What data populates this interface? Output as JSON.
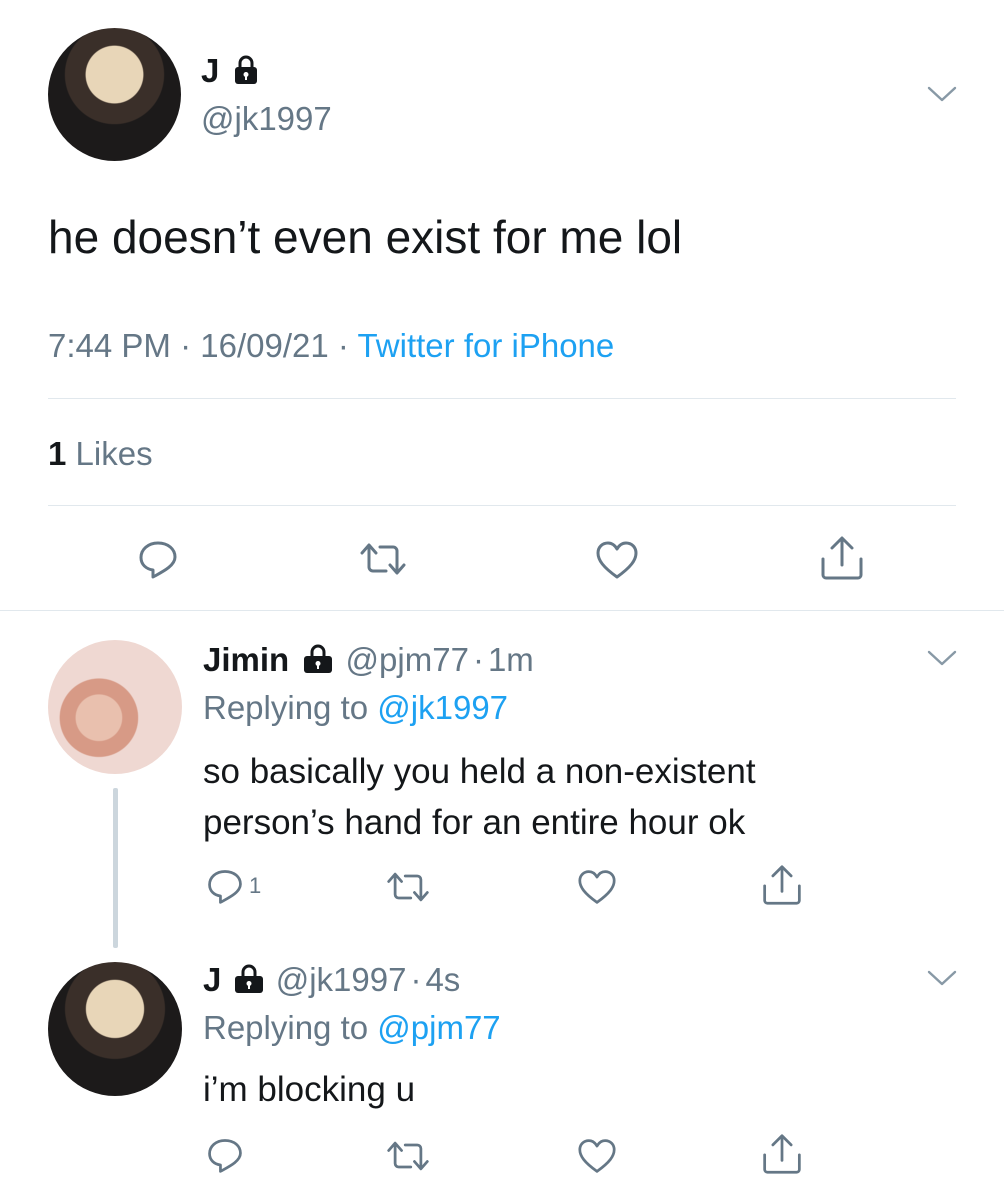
{
  "main_tweet": {
    "name": "J",
    "handle": "@jk1997",
    "text": "he doesn’t even exist for me lol",
    "time": "7:44 PM",
    "sep1": "·",
    "date": "16/09/21",
    "sep2": "·",
    "source": "Twitter for iPhone",
    "likes_count": "1",
    "likes_label": "Likes"
  },
  "reply1": {
    "name": "Jimin",
    "handle": "@pjm77",
    "dot": "·",
    "time": "1m",
    "replying_prefix": "Replying to",
    "replying_to": "@jk1997",
    "line1": "so basically you held a non-existent",
    "line2": "person’s hand for an entire hour ok",
    "reply_count": "1"
  },
  "reply2": {
    "name": "J",
    "handle": "@jk1997",
    "dot": "·",
    "time": "4s",
    "replying_prefix": "Replying to",
    "replying_to": "@pjm77",
    "text": "i’m blocking u"
  },
  "colors": {
    "link": "#1da1f2",
    "secondary": "#657786",
    "divider": "#e1e8ed",
    "text": "#14171a"
  }
}
